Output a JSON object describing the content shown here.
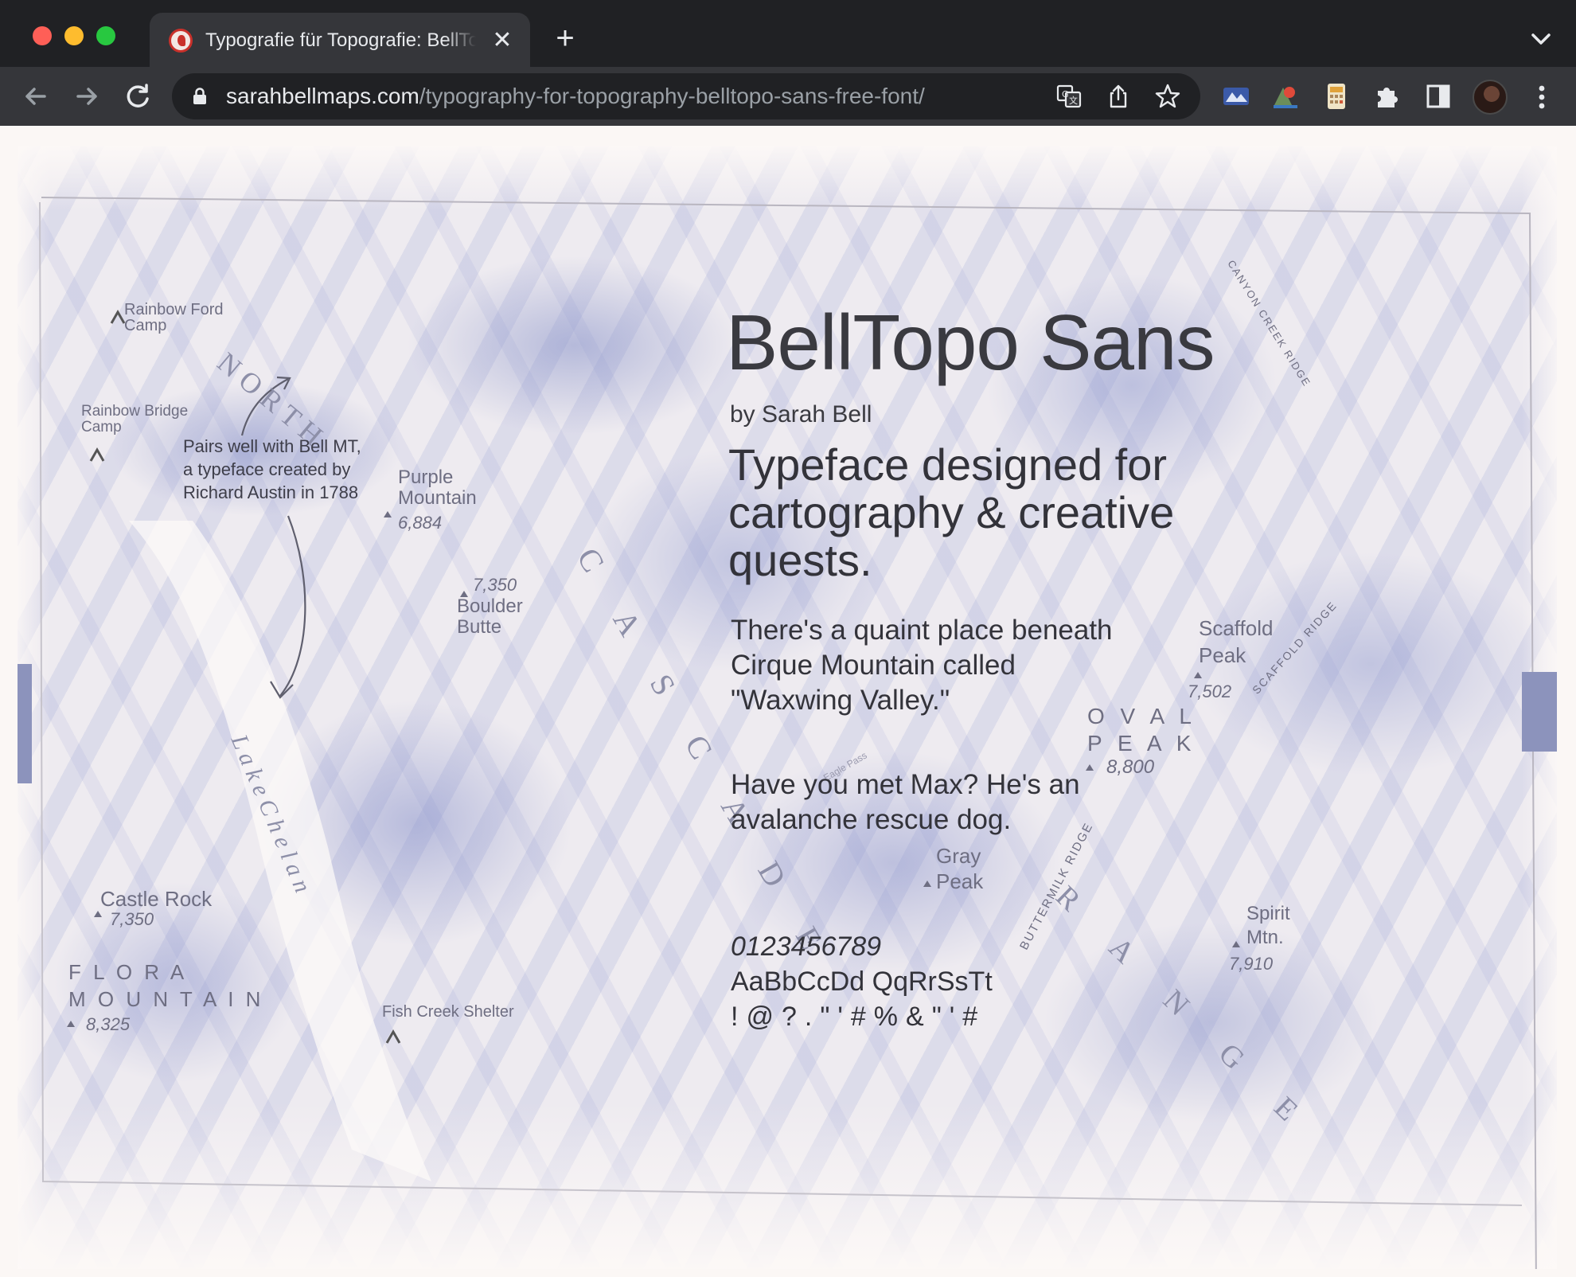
{
  "browser": {
    "tab_title": "Typografie für Topografie: BellTopo Sans",
    "tab_close": "✕",
    "new_tab": "+",
    "url_host": "sarahbellmaps.com",
    "url_path": "/typography-for-topography-belltopo-sans-free-font/",
    "icons": [
      "back-icon",
      "forward-icon",
      "reload-icon",
      "lock-icon",
      "translate-icon",
      "share-icon",
      "star-icon",
      "extensions-icon",
      "side-panel-icon",
      "more-icon"
    ]
  },
  "hero": {
    "title": "BellTopo Sans",
    "author": "by Sarah Bell",
    "tagline": "Typeface designed for cartography & creative quests.",
    "paragraph_1": "There's a quaint place beneath Cirque Mountain called \"Waxwing Valley.\"",
    "paragraph_2": "Have you met Max? He's an avalanche rescue dog.",
    "numerals": "0123456789",
    "letters": "AaBbCcDd QqRrSsTt",
    "symbols": "!@?.\"'#%&\"'#"
  },
  "map_labels": {
    "rainbow_ford_1": "Rainbow Ford",
    "rainbow_ford_2": "Camp",
    "rainbow_bridge_1": "Rainbow Bridge",
    "rainbow_bridge_2": "Camp",
    "north": "N O R T H",
    "note_1": "Pairs well with Bell MT,",
    "note_2": "a typeface created by",
    "note_3": "Richard Austin in 1788",
    "purple_1": "Purple",
    "purple_2": "Mountain",
    "purple_elev": "6,884",
    "boulder_elev": "7,350",
    "boulder_1": "Boulder",
    "boulder_2": "Butte",
    "lake": "L a k e   C h e l a n",
    "castle": "Castle Rock",
    "castle_elev": "7,350",
    "flora_1": "F L O R A",
    "flora_2": "M O U N T A I N",
    "flora_elev": "8,325",
    "fish": "Fish Creek Shelter",
    "cascade": "C A S C A D E",
    "canyon": "CANYON CREEK RIDGE",
    "scaffold_1": "Scaffold",
    "scaffold_2": "Peak",
    "scaffold_elev": "7,502",
    "scaffold_ridge": "SCAFFOLD RIDGE",
    "oval_1": "O V A L",
    "oval_2": "P E A K",
    "oval_elev": "8,800",
    "gray_1": "Gray",
    "gray_2": "Peak",
    "buttermilk": "BUTTERMILK RIDGE",
    "range": "R A N G E",
    "spirit_1": "Spirit",
    "spirit_2": "Mtn.",
    "spirit_elev": "7,910",
    "eagle": "Eagle Pass"
  }
}
